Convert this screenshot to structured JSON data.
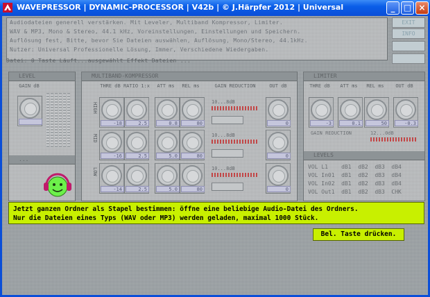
{
  "window": {
    "title": "WAVEPRESSOR | DYNAMIC-PROCESSOR | V42b | © J.Härpfer 2012 | Universal",
    "buttons": {
      "minimize": "_",
      "maximize": "□",
      "close": "×"
    }
  },
  "info": {
    "lines": [
      "Audiodateien generell verstärken. Mit Leveler, Multiband Kompressor, Limiter.",
      "WAV & MP3, Mono & Stereo, 44.1 kHz, Voreinstellungen, Einstellungen und Speichern.",
      "Auflösung fest, Bitte, bevor Sie Dateien auswählen, Auflösung, Mono/Stereo, 44.1kHz.",
      "Nutzer: Universal          Professionelle Lösung, Immer, Verschiedene Wiedergaben."
    ],
    "status_line": "Datei:   0 Taste  Läuft...ausgewählt   Effekt    Dateien ..."
  },
  "side_buttons": [
    "EXIT",
    "INFO",
    "",
    ""
  ],
  "left_panel": {
    "header": "LEVEL",
    "knob_label": "GAIN dB",
    "sub_header": "..."
  },
  "compressor": {
    "header": "MULTIBAND-KOMPRESSOR",
    "col_labels": [
      "THRE dB",
      "RATIO 1:x",
      "ATT ms",
      "REL ms",
      "GAIN REDUCTION",
      "OUT dB"
    ],
    "bands": [
      {
        "name": "HIGH",
        "values": [
          "-18",
          "2.5",
          "0.8",
          "80"
        ],
        "gr": "10...8dB",
        "out": "0"
      },
      {
        "name": "MID",
        "values": [
          "-16",
          "2.5",
          "5.0",
          "80"
        ],
        "gr": "10...8dB",
        "out": "0"
      },
      {
        "name": "LOW",
        "values": [
          "-14",
          "2.5",
          "5.0",
          "80"
        ],
        "gr": "10...8dB",
        "out": "0"
      }
    ]
  },
  "limiter": {
    "header": "LIMITER",
    "col_labels": [
      "THRE dB",
      "ATT ms",
      "REL ms",
      "OUT dB"
    ],
    "values": [
      "-3",
      "0.1",
      "50",
      "-0.3"
    ],
    "gain_reduction_label": "GAIN REDUCTION",
    "gr_range": "12...0dB",
    "levels_header": "LEVELS",
    "level_rows": [
      "VOL L1    dB1  dB2  dB3  dB4",
      "VOL In01  dB1  dB2  dB3  dB4",
      "VOL In02  dB1  dB2  dB3  dB4",
      "VOL Out1  dB1  dB2  dB3  CHK"
    ]
  },
  "message": {
    "line1": "Jetzt ganzen Ordner als Stapel bestimmen: öffne eine beliebige Audio-Datei des Ordners.",
    "line2": "Nur die Dateien eines Typs (WAV oder MP3) werden geladen, maximal 1000 Stück."
  },
  "key_prompt": "Bel. Taste drücken.",
  "colors": {
    "accent_yellow": "#C8F000",
    "title_blue": "#0A4ED8",
    "smiley_green": "#6CF04A",
    "smiley_headphones": "#C01A6A"
  }
}
